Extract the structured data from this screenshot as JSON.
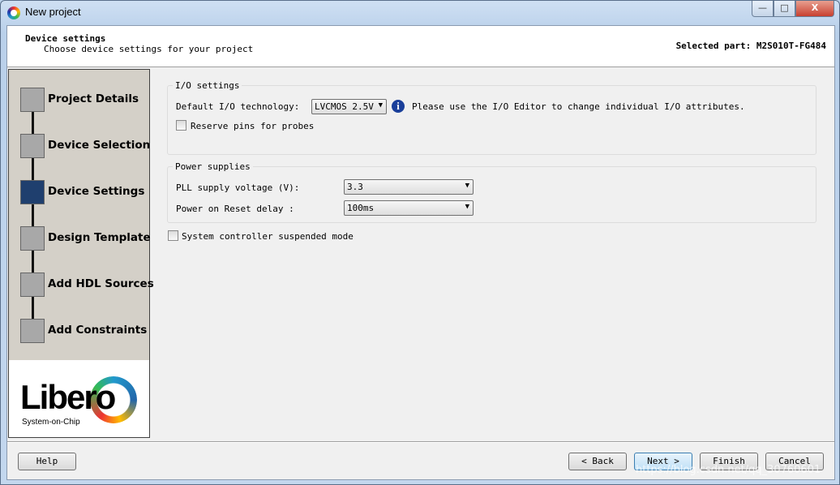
{
  "window": {
    "title": "New project",
    "controls": {
      "minimize": "—",
      "maximize": "□",
      "close": "X"
    }
  },
  "header": {
    "title": "Device settings",
    "subtitle": "Choose device settings for your project",
    "selected_part": "Selected part: M2S010T-FG484"
  },
  "sidebar": {
    "steps": [
      {
        "label": "Project Details",
        "active": false
      },
      {
        "label": "Device Selection",
        "active": false
      },
      {
        "label": "Device Settings",
        "active": true
      },
      {
        "label": "Design Template",
        "active": false
      },
      {
        "label": "Add HDL Sources",
        "active": false
      },
      {
        "label": "Add Constraints",
        "active": false
      }
    ],
    "logo": {
      "text": "Libero",
      "sub": "System-on-Chip"
    }
  },
  "io_settings": {
    "legend": "I/O settings",
    "tech_label": "Default I/O technology:",
    "tech_value": "LVCMOS 2.5V",
    "info_text": "Please use the I/O Editor to change individual I/O attributes.",
    "reserve_pins_label": "Reserve pins for probes",
    "reserve_pins_checked": false
  },
  "power": {
    "legend": "Power supplies",
    "pll_label": "PLL supply voltage (V):",
    "pll_value": "3.3",
    "por_label": "Power on Reset delay :",
    "por_value": "100ms"
  },
  "suspended": {
    "label": "System controller suspended mode",
    "checked": false
  },
  "buttons": {
    "help": "Help",
    "back": "< Back",
    "next": "Next >",
    "finish": "Finish",
    "cancel": "Cancel"
  },
  "watermark": "https://blog.csdn.net/qq_30760601"
}
